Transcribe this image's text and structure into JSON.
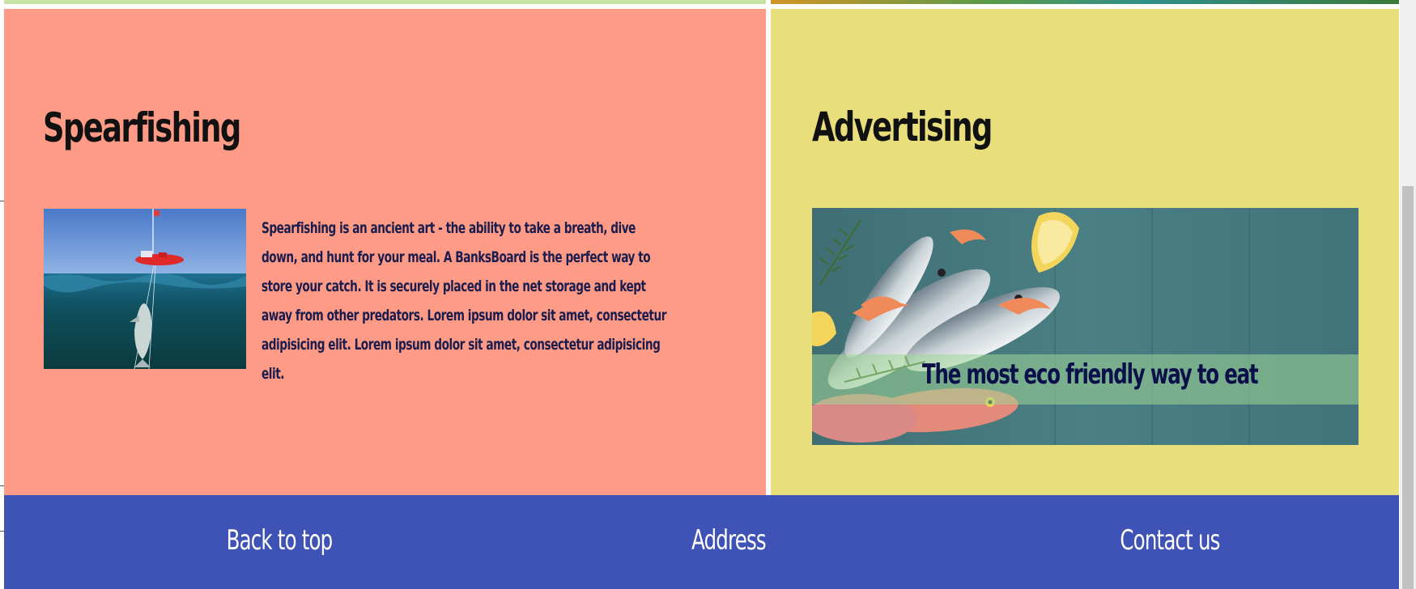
{
  "sections": {
    "spearfishing": {
      "title": "Spearfishing",
      "body": "Spearfishing is an ancient art - the ability to take a breath, dive down, and hunt for your meal. A BanksBoard is the perfect way to store your catch. It is securely placed in the net storage and kept away from other predators. Lorem ipsum dolor sit amet, consectetur adipisicing elit. Lorem ipsum dolor sit amet, consectetur adipisicing elit.",
      "background": "#fd9b87"
    },
    "advertising": {
      "title": "Advertising",
      "caption": "The most eco friendly way to eat",
      "background": "#e8df7c"
    }
  },
  "footer": {
    "background": "#3f52b5",
    "links": {
      "back_to_top": "Back to top",
      "address": "Address",
      "contact_us": "Contact us"
    }
  }
}
